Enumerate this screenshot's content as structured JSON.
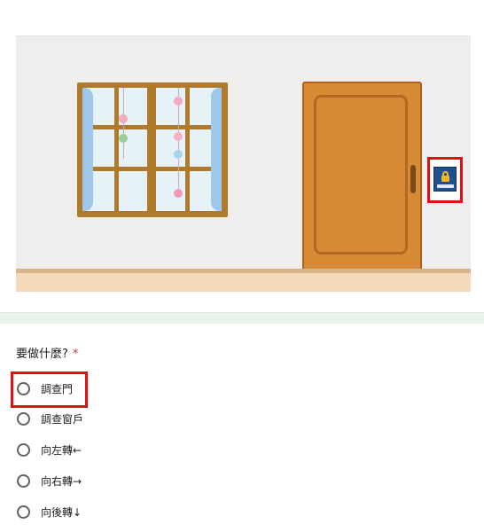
{
  "question": {
    "text": "要做什麼?",
    "required_mark": "*"
  },
  "options": [
    {
      "label": "調查門"
    },
    {
      "label": "調查窗戶"
    },
    {
      "label": "向左轉←"
    },
    {
      "label": "向右轉→"
    },
    {
      "label": "向後轉↓"
    }
  ],
  "colors": {
    "highlight": "#e01010",
    "required": "#d93025",
    "door": "#d98a35",
    "window_frame": "#b07a2c"
  },
  "icons": {
    "door_lock": "lock-panel-icon"
  }
}
